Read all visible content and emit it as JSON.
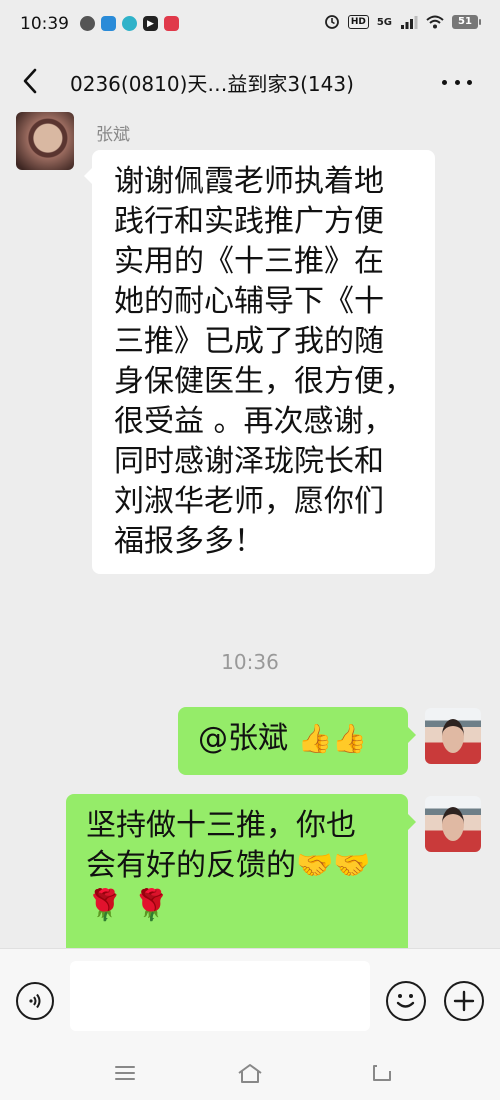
{
  "status_bar": {
    "time": "10:39",
    "network": "5G",
    "hd": "HD",
    "battery": "51"
  },
  "header": {
    "title": "0236(0810)天…益到家3(143)"
  },
  "messages": [
    {
      "sender": "张斌",
      "side": "left",
      "text": "谢谢佩霞老师执着地践行和实践推广方便实用的《十三推》在她的耐心辅导下《十三推》已成了我的随身保健医生，很方便，很受益 。再次感谢，同时感谢泽珑院长和刘淑华老师，愿你们福报多多！",
      "lines": [
        "谢谢佩霞老师执着地",
        "践行和实践推广方便",
        "实用的《十三推》在",
        "她的耐心辅导下《十",
        "三推》已成了我的随",
        "身保健医生，很方便，",
        "很受益 。再次感谢，",
        "同时感谢泽珑院长和",
        "刘淑华老师，愿你们",
        "福报多多！"
      ]
    },
    {
      "side": "right",
      "text": "@张斌",
      "emoji": "👍👍"
    },
    {
      "side": "right",
      "lines": [
        "坚持做十三推，你也",
        "会有好的反馈的🤝🤝",
        "🌹 🌹"
      ]
    }
  ],
  "timestamp": "10:36",
  "input": {
    "value": ""
  },
  "icons": {
    "back": "chevron-left-icon",
    "more": "more-dots-icon",
    "voice": "voice-icon",
    "emoji": "emoji-smile-icon",
    "plus": "plus-icon",
    "nav_menu": "menu-icon",
    "nav_home": "home-icon",
    "nav_back": "back-icon"
  },
  "colors": {
    "background": "#ededed",
    "bubble_self": "#95ec69",
    "bubble_other": "#ffffff"
  }
}
